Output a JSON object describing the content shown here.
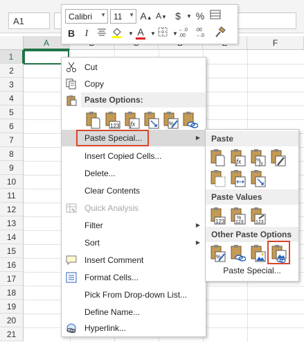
{
  "namebox": {
    "value": "A1"
  },
  "columns": [
    "A",
    "B",
    "C",
    "D",
    "E",
    "F"
  ],
  "rows": [
    "1",
    "2",
    "3",
    "4",
    "5",
    "6",
    "7",
    "8",
    "9",
    "10",
    "11",
    "12",
    "13",
    "14",
    "15",
    "16",
    "17",
    "18",
    "19",
    "20",
    "21"
  ],
  "mini_toolbar": {
    "font": "Calibri",
    "size": "11",
    "grow_font": "A",
    "shrink_font": "A",
    "currency": "$",
    "percent": "%",
    "bold": "B",
    "italic": "I",
    "font_color": "A"
  },
  "context_menu": {
    "cut": "Cut",
    "copy": "Copy",
    "paste_options_header": "Paste Options:",
    "paste_special": "Paste Special...",
    "insert_copied": "Insert Copied Cells...",
    "delete": "Delete...",
    "clear_contents": "Clear Contents",
    "quick_analysis": "Quick Analysis",
    "filter": "Filter",
    "sort": "Sort",
    "insert_comment": "Insert Comment",
    "format_cells": "Format Cells...",
    "pick_dropdown": "Pick From Drop-down List...",
    "define_name": "Define Name...",
    "hyperlink": "Hyperlink..."
  },
  "submenu": {
    "paste_header": "Paste",
    "paste_values_header": "Paste Values",
    "other_header": "Other Paste Options",
    "paste_special": "Paste Special..."
  },
  "colors": {
    "excel_green": "#217346",
    "highlight_red": "#d9452a",
    "clipboard_brown": "#c49a55",
    "menu_highlight": "#d9d9d9"
  }
}
